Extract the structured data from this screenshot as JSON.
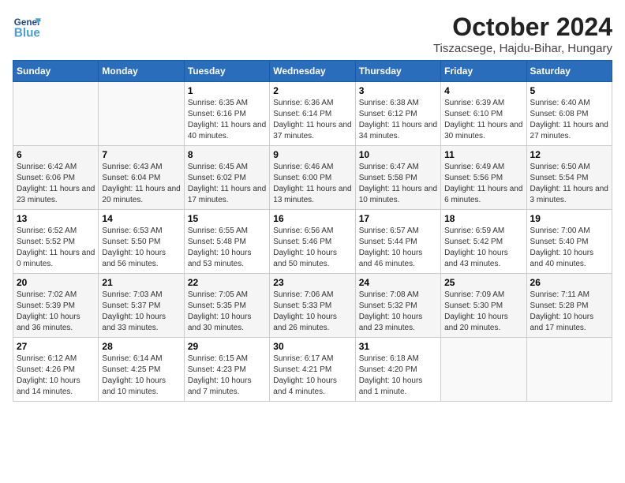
{
  "header": {
    "logo_general": "General",
    "logo_blue": "Blue",
    "month_title": "October 2024",
    "location": "Tiszacsege, Hajdu-Bihar, Hungary"
  },
  "weekdays": [
    "Sunday",
    "Monday",
    "Tuesday",
    "Wednesday",
    "Thursday",
    "Friday",
    "Saturday"
  ],
  "weeks": [
    [
      {
        "day": "",
        "info": ""
      },
      {
        "day": "",
        "info": ""
      },
      {
        "day": "1",
        "info": "Sunrise: 6:35 AM\nSunset: 6:16 PM\nDaylight: 11 hours and 40 minutes."
      },
      {
        "day": "2",
        "info": "Sunrise: 6:36 AM\nSunset: 6:14 PM\nDaylight: 11 hours and 37 minutes."
      },
      {
        "day": "3",
        "info": "Sunrise: 6:38 AM\nSunset: 6:12 PM\nDaylight: 11 hours and 34 minutes."
      },
      {
        "day": "4",
        "info": "Sunrise: 6:39 AM\nSunset: 6:10 PM\nDaylight: 11 hours and 30 minutes."
      },
      {
        "day": "5",
        "info": "Sunrise: 6:40 AM\nSunset: 6:08 PM\nDaylight: 11 hours and 27 minutes."
      }
    ],
    [
      {
        "day": "6",
        "info": "Sunrise: 6:42 AM\nSunset: 6:06 PM\nDaylight: 11 hours and 23 minutes."
      },
      {
        "day": "7",
        "info": "Sunrise: 6:43 AM\nSunset: 6:04 PM\nDaylight: 11 hours and 20 minutes."
      },
      {
        "day": "8",
        "info": "Sunrise: 6:45 AM\nSunset: 6:02 PM\nDaylight: 11 hours and 17 minutes."
      },
      {
        "day": "9",
        "info": "Sunrise: 6:46 AM\nSunset: 6:00 PM\nDaylight: 11 hours and 13 minutes."
      },
      {
        "day": "10",
        "info": "Sunrise: 6:47 AM\nSunset: 5:58 PM\nDaylight: 11 hours and 10 minutes."
      },
      {
        "day": "11",
        "info": "Sunrise: 6:49 AM\nSunset: 5:56 PM\nDaylight: 11 hours and 6 minutes."
      },
      {
        "day": "12",
        "info": "Sunrise: 6:50 AM\nSunset: 5:54 PM\nDaylight: 11 hours and 3 minutes."
      }
    ],
    [
      {
        "day": "13",
        "info": "Sunrise: 6:52 AM\nSunset: 5:52 PM\nDaylight: 11 hours and 0 minutes."
      },
      {
        "day": "14",
        "info": "Sunrise: 6:53 AM\nSunset: 5:50 PM\nDaylight: 10 hours and 56 minutes."
      },
      {
        "day": "15",
        "info": "Sunrise: 6:55 AM\nSunset: 5:48 PM\nDaylight: 10 hours and 53 minutes."
      },
      {
        "day": "16",
        "info": "Sunrise: 6:56 AM\nSunset: 5:46 PM\nDaylight: 10 hours and 50 minutes."
      },
      {
        "day": "17",
        "info": "Sunrise: 6:57 AM\nSunset: 5:44 PM\nDaylight: 10 hours and 46 minutes."
      },
      {
        "day": "18",
        "info": "Sunrise: 6:59 AM\nSunset: 5:42 PM\nDaylight: 10 hours and 43 minutes."
      },
      {
        "day": "19",
        "info": "Sunrise: 7:00 AM\nSunset: 5:40 PM\nDaylight: 10 hours and 40 minutes."
      }
    ],
    [
      {
        "day": "20",
        "info": "Sunrise: 7:02 AM\nSunset: 5:39 PM\nDaylight: 10 hours and 36 minutes."
      },
      {
        "day": "21",
        "info": "Sunrise: 7:03 AM\nSunset: 5:37 PM\nDaylight: 10 hours and 33 minutes."
      },
      {
        "day": "22",
        "info": "Sunrise: 7:05 AM\nSunset: 5:35 PM\nDaylight: 10 hours and 30 minutes."
      },
      {
        "day": "23",
        "info": "Sunrise: 7:06 AM\nSunset: 5:33 PM\nDaylight: 10 hours and 26 minutes."
      },
      {
        "day": "24",
        "info": "Sunrise: 7:08 AM\nSunset: 5:32 PM\nDaylight: 10 hours and 23 minutes."
      },
      {
        "day": "25",
        "info": "Sunrise: 7:09 AM\nSunset: 5:30 PM\nDaylight: 10 hours and 20 minutes."
      },
      {
        "day": "26",
        "info": "Sunrise: 7:11 AM\nSunset: 5:28 PM\nDaylight: 10 hours and 17 minutes."
      }
    ],
    [
      {
        "day": "27",
        "info": "Sunrise: 6:12 AM\nSunset: 4:26 PM\nDaylight: 10 hours and 14 minutes."
      },
      {
        "day": "28",
        "info": "Sunrise: 6:14 AM\nSunset: 4:25 PM\nDaylight: 10 hours and 10 minutes."
      },
      {
        "day": "29",
        "info": "Sunrise: 6:15 AM\nSunset: 4:23 PM\nDaylight: 10 hours and 7 minutes."
      },
      {
        "day": "30",
        "info": "Sunrise: 6:17 AM\nSunset: 4:21 PM\nDaylight: 10 hours and 4 minutes."
      },
      {
        "day": "31",
        "info": "Sunrise: 6:18 AM\nSunset: 4:20 PM\nDaylight: 10 hours and 1 minute."
      },
      {
        "day": "",
        "info": ""
      },
      {
        "day": "",
        "info": ""
      }
    ]
  ]
}
